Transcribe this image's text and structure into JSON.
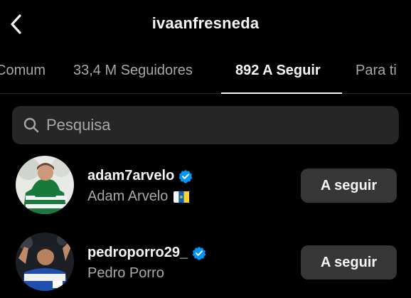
{
  "header": {
    "title": "ivaanfresneda"
  },
  "tabs": [
    {
      "label": "Comum"
    },
    {
      "label": "33,4 M Seguidores"
    },
    {
      "label": "892 A Seguir",
      "active": true
    },
    {
      "label": "Para ti"
    }
  ],
  "search": {
    "placeholder": "Pesquisa"
  },
  "accounts": [
    {
      "username": "adam7arvelo",
      "full_name": "Adam Arvelo",
      "verified": true,
      "flag_icon": "canary-islands-flag-icon",
      "button_label": "A seguir"
    },
    {
      "username": "pedroporro29_",
      "full_name": "Pedro Porro",
      "verified": true,
      "button_label": "A seguir"
    }
  ],
  "colors": {
    "background": "#000000",
    "primary_text": "#f5f5f5",
    "secondary_text": "#a8a8a8",
    "search_bg": "#262626",
    "button_bg": "#363636",
    "verified_blue": "#0095f6"
  }
}
